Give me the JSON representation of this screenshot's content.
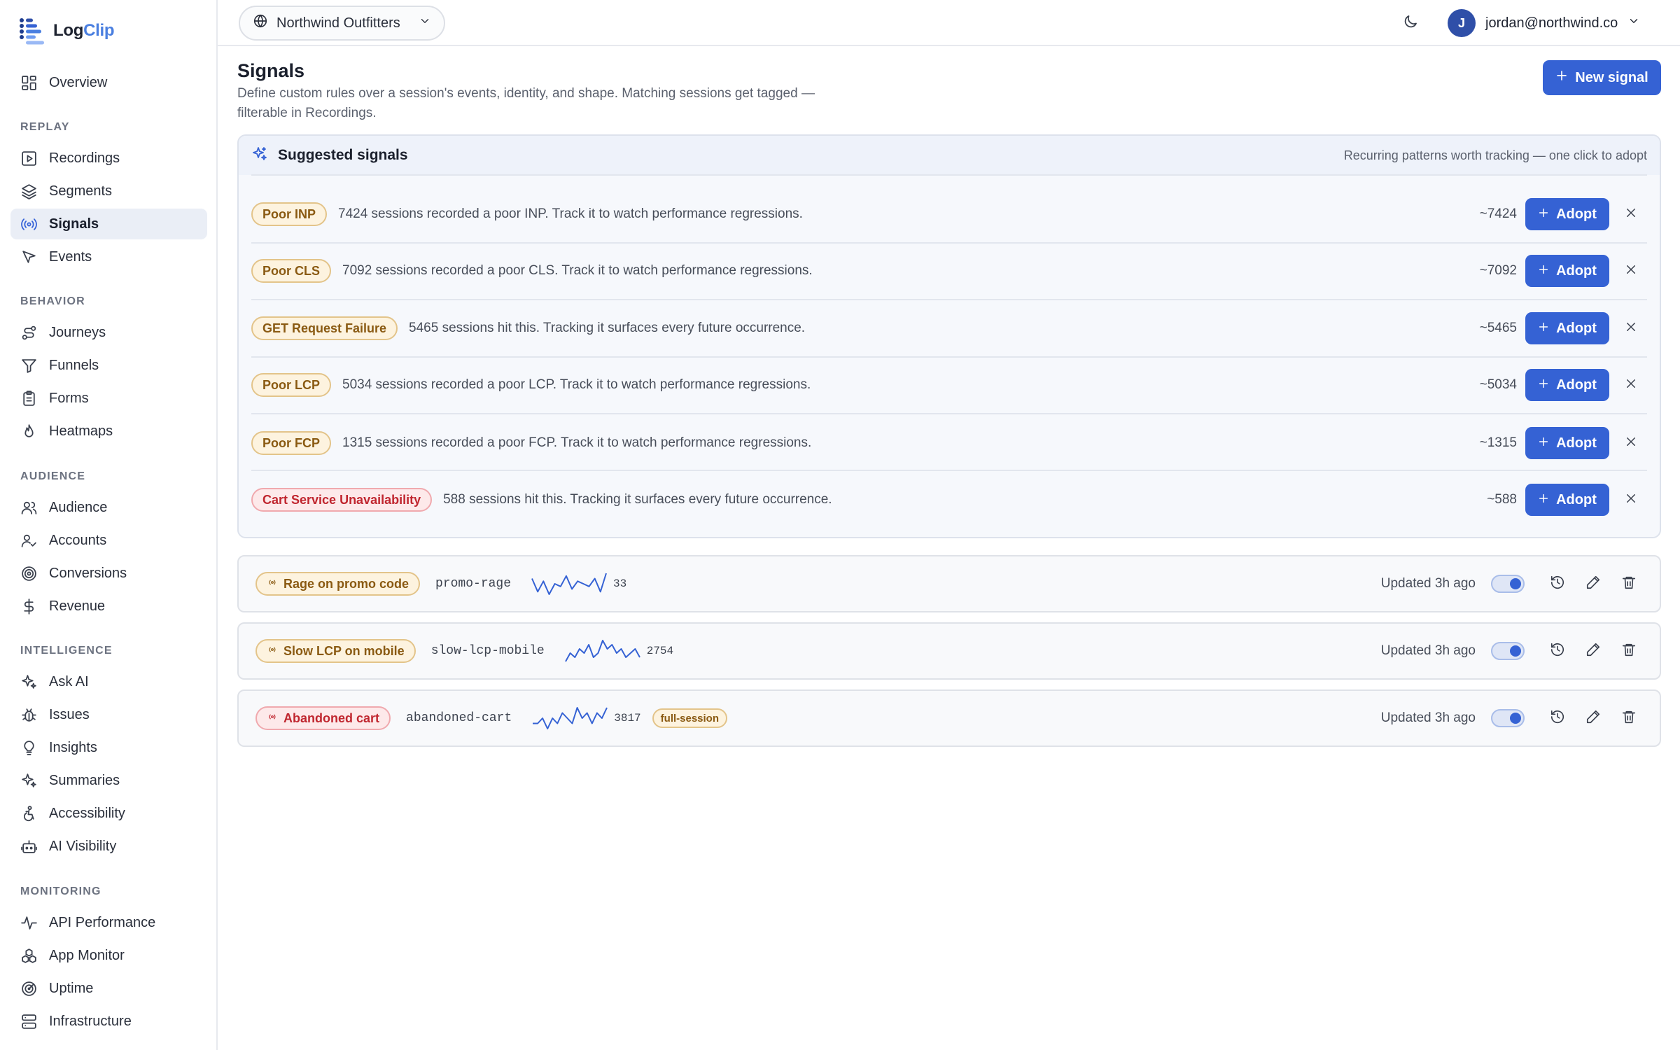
{
  "brand": {
    "name_part1": "Log",
    "name_part2": "Clip"
  },
  "sidebar": {
    "top": [
      {
        "label": "Overview",
        "icon": "dashboard-icon"
      }
    ],
    "sections": [
      {
        "label": "REPLAY",
        "items": [
          {
            "label": "Recordings",
            "icon": "play-square-icon"
          },
          {
            "label": "Segments",
            "icon": "layers-icon"
          },
          {
            "label": "Signals",
            "icon": "broadcast-icon",
            "active": true
          },
          {
            "label": "Events",
            "icon": "cursor-icon"
          }
        ]
      },
      {
        "label": "BEHAVIOR",
        "items": [
          {
            "label": "Journeys",
            "icon": "route-icon"
          },
          {
            "label": "Funnels",
            "icon": "funnel-icon"
          },
          {
            "label": "Forms",
            "icon": "clipboard-icon"
          },
          {
            "label": "Heatmaps",
            "icon": "flame-icon"
          }
        ]
      },
      {
        "label": "AUDIENCE",
        "items": [
          {
            "label": "Audience",
            "icon": "users-icon"
          },
          {
            "label": "Accounts",
            "icon": "user-check-icon"
          },
          {
            "label": "Conversions",
            "icon": "target-icon"
          },
          {
            "label": "Revenue",
            "icon": "dollar-icon"
          }
        ]
      },
      {
        "label": "INTELLIGENCE",
        "items": [
          {
            "label": "Ask AI",
            "icon": "sparkles-icon"
          },
          {
            "label": "Issues",
            "icon": "bug-icon"
          },
          {
            "label": "Insights",
            "icon": "lightbulb-icon"
          },
          {
            "label": "Summaries",
            "icon": "sparkles-icon"
          },
          {
            "label": "Accessibility",
            "icon": "accessibility-icon"
          },
          {
            "label": "AI Visibility",
            "icon": "bot-icon"
          }
        ]
      },
      {
        "label": "MONITORING",
        "items": [
          {
            "label": "API Performance",
            "icon": "activity-icon"
          },
          {
            "label": "App Monitor",
            "icon": "boxes-icon"
          },
          {
            "label": "Uptime",
            "icon": "radar-icon"
          },
          {
            "label": "Infrastructure",
            "icon": "server-icon"
          }
        ]
      }
    ]
  },
  "topbar": {
    "org_name": "Northwind Outfitters",
    "user_email": "jordan@northwind.co",
    "user_initial": "J"
  },
  "page": {
    "title": "Signals",
    "description": "Define custom rules over a session's events, identity, and shape. Matching sessions get tagged — filterable in Recordings.",
    "new_signal_label": "New signal"
  },
  "suggested": {
    "title": "Suggested signals",
    "subtitle": "Recurring patterns worth tracking — one click to adopt",
    "adopt_label": "Adopt",
    "items": [
      {
        "name": "Poor INP",
        "tone": "amber",
        "desc": "7424 sessions recorded a poor INP. Track it to watch performance regressions.",
        "count": "~7424"
      },
      {
        "name": "Poor CLS",
        "tone": "amber",
        "desc": "7092 sessions recorded a poor CLS. Track it to watch performance regressions.",
        "count": "~7092"
      },
      {
        "name": "GET Request Failure",
        "tone": "amber",
        "desc": "5465 sessions hit this. Tracking it surfaces every future occurrence.",
        "count": "~5465"
      },
      {
        "name": "Poor LCP",
        "tone": "amber",
        "desc": "5034 sessions recorded a poor LCP. Track it to watch performance regressions.",
        "count": "~5034"
      },
      {
        "name": "Poor FCP",
        "tone": "amber",
        "desc": "1315 sessions recorded a poor FCP. Track it to watch performance regressions.",
        "count": "~1315"
      },
      {
        "name": "Cart Service Unavailability",
        "tone": "red",
        "desc": "588 sessions hit this. Tracking it surfaces every future occurrence.",
        "count": "~588"
      }
    ]
  },
  "signals": [
    {
      "name": "Rage on promo code",
      "tone": "amber",
      "slug": "promo-rage",
      "count": "33",
      "tag": "",
      "updated": "Updated 3h ago",
      "enabled": true,
      "spark": [
        7,
        2,
        6,
        1,
        5,
        4,
        8,
        3,
        6,
        5,
        4,
        7,
        2,
        9
      ]
    },
    {
      "name": "Slow LCP on mobile",
      "tone": "amber",
      "slug": "slow-lcp-mobile",
      "count": "2754",
      "tag": "",
      "updated": "Updated 3h ago",
      "enabled": true,
      "spark": [
        4,
        6,
        5,
        7,
        6,
        8,
        5,
        6,
        9,
        7,
        8,
        6,
        7,
        5,
        6,
        7,
        5
      ]
    },
    {
      "name": "Abandoned cart",
      "tone": "red",
      "slug": "abandoned-cart",
      "count": "3817",
      "tag": "full-session",
      "updated": "Updated 3h ago",
      "enabled": true,
      "spark": [
        5,
        5,
        6,
        4,
        6,
        5,
        7,
        6,
        5,
        8,
        6,
        7,
        5,
        7,
        6,
        8
      ]
    }
  ]
}
